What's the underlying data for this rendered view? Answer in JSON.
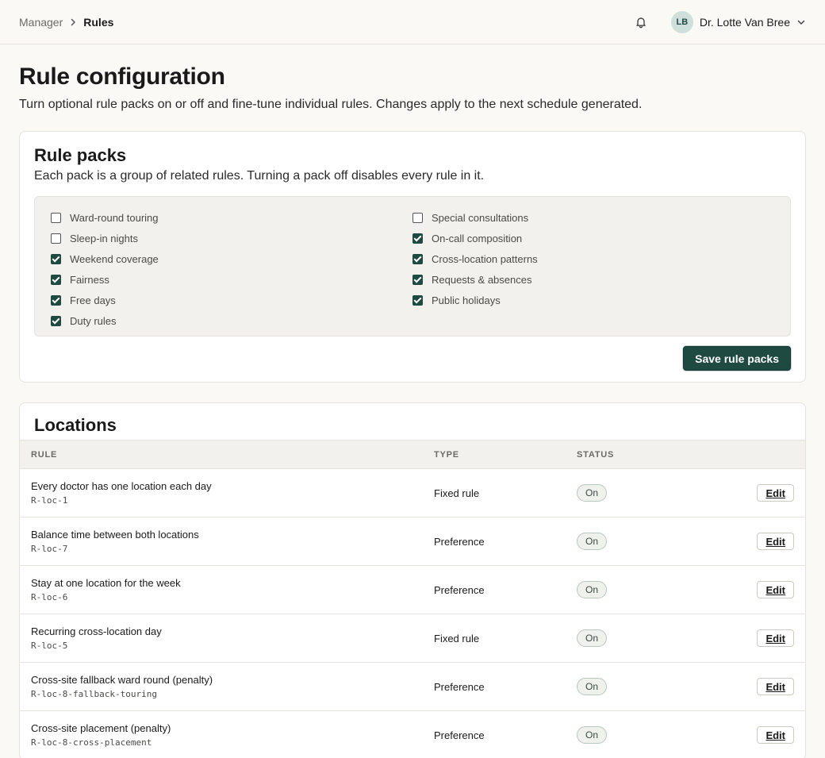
{
  "breadcrumb": {
    "parent": "Manager",
    "current": "Rules"
  },
  "user": {
    "initials": "LB",
    "name": "Dr. Lotte Van Bree"
  },
  "page": {
    "title": "Rule configuration",
    "subtitle": "Turn optional rule packs on or off and fine-tune individual rules. Changes apply to the next schedule generated."
  },
  "packs": {
    "title": "Rule packs",
    "subtitle": "Each pack is a group of related rules. Turning a pack off disables every rule in it.",
    "left": [
      {
        "label": "Ward-round touring",
        "checked": false
      },
      {
        "label": "Sleep-in nights",
        "checked": false
      },
      {
        "label": "Weekend coverage",
        "checked": true
      },
      {
        "label": "Fairness",
        "checked": true
      },
      {
        "label": "Free days",
        "checked": true
      },
      {
        "label": "Duty rules",
        "checked": true
      }
    ],
    "right": [
      {
        "label": "Special consultations",
        "checked": false
      },
      {
        "label": "On-call composition",
        "checked": true
      },
      {
        "label": "Cross-location patterns",
        "checked": true
      },
      {
        "label": "Requests & absences",
        "checked": true
      },
      {
        "label": "Public holidays",
        "checked": true
      }
    ],
    "save_label": "Save rule packs"
  },
  "locations": {
    "title": "Locations",
    "headers": {
      "rule": "RULE",
      "type": "TYPE",
      "status": "STATUS"
    },
    "rows": [
      {
        "name": "Every doctor has one location each day",
        "id": "R-loc-1",
        "type": "Fixed rule",
        "status": "On",
        "action": "Edit"
      },
      {
        "name": "Balance time between both locations",
        "id": "R-loc-7",
        "type": "Preference",
        "status": "On",
        "action": "Edit"
      },
      {
        "name": "Stay at one location for the week",
        "id": "R-loc-6",
        "type": "Preference",
        "status": "On",
        "action": "Edit"
      },
      {
        "name": "Recurring cross-location day",
        "id": "R-loc-5",
        "type": "Fixed rule",
        "status": "On",
        "action": "Edit"
      },
      {
        "name": "Cross-site fallback ward round (penalty)",
        "id": "R-loc-8-fallback-touring",
        "type": "Preference",
        "status": "On",
        "action": "Edit"
      },
      {
        "name": "Cross-site placement (penalty)",
        "id": "R-loc-8-cross-placement",
        "type": "Preference",
        "status": "On",
        "action": "Edit"
      }
    ]
  },
  "colors": {
    "accent": "#1f4a42",
    "pill_bg": "#eef1ec",
    "panel_bg": "#f3f1ed"
  },
  "icons": {
    "bell": "bell-icon",
    "breadcrumb_sep": "chevron-right-icon",
    "user_menu": "chevron-down-icon"
  }
}
